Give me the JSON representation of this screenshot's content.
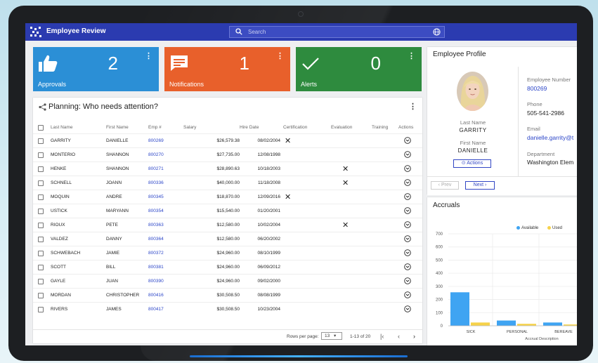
{
  "header": {
    "app_title": "Employee Review",
    "search_placeholder": "Search"
  },
  "tiles": [
    {
      "label": "Approvals",
      "count": "2",
      "color": "#2b8fd6",
      "icon": "thumbs-up-icon"
    },
    {
      "label": "Notifications",
      "count": "1",
      "color": "#e8602b",
      "icon": "message-icon"
    },
    {
      "label": "Alerts",
      "count": "0",
      "color": "#2e8b3e",
      "icon": "check-icon"
    }
  ],
  "planning": {
    "title": "Planning: Who needs attention?",
    "columns": [
      "Last Name",
      "First Name",
      "Emp #",
      "Salary",
      "Hire Date",
      "Certification",
      "Evaluation",
      "Training",
      "Actions"
    ],
    "rows": [
      {
        "last": "GARRITY",
        "first": "DANIELLE",
        "emp": "800269",
        "salary": "$26,579.38",
        "hire": "08/02/2004",
        "cert": "✕",
        "eval": ""
      },
      {
        "last": "MONTERIO",
        "first": "SHANNON",
        "emp": "800270",
        "salary": "$27,735.00",
        "hire": "12/08/1998",
        "cert": "",
        "eval": ""
      },
      {
        "last": "HENKE",
        "first": "SHANNON",
        "emp": "800271",
        "salary": "$28,890.63",
        "hire": "10/18/2003",
        "cert": "",
        "eval": "✕"
      },
      {
        "last": "SCHNELL",
        "first": "JOANN",
        "emp": "800336",
        "salary": "$40,000.00",
        "hire": "11/18/2008",
        "cert": "",
        "eval": "✕"
      },
      {
        "last": "MOQUIN",
        "first": "ANDRE",
        "emp": "800345",
        "salary": "$18,870.00",
        "hire": "12/09/2016",
        "cert": "✕",
        "eval": ""
      },
      {
        "last": "USTICK",
        "first": "MARYANN",
        "emp": "800354",
        "salary": "$15,540.00",
        "hire": "01/20/2001",
        "cert": "",
        "eval": ""
      },
      {
        "last": "RIOUX",
        "first": "PETE",
        "emp": "800363",
        "salary": "$12,580.00",
        "hire": "10/02/2004",
        "cert": "",
        "eval": "✕"
      },
      {
        "last": "VALDEZ",
        "first": "DANNY",
        "emp": "800364",
        "salary": "$12,580.00",
        "hire": "06/20/2002",
        "cert": "",
        "eval": ""
      },
      {
        "last": "SCHWEBACH",
        "first": "JAMIE",
        "emp": "800372",
        "salary": "$24,960.00",
        "hire": "08/10/1999",
        "cert": "",
        "eval": ""
      },
      {
        "last": "SCOTT",
        "first": "BILL",
        "emp": "800381",
        "salary": "$24,960.00",
        "hire": "06/09/2012",
        "cert": "",
        "eval": ""
      },
      {
        "last": "GAYLE",
        "first": "JUAN",
        "emp": "800390",
        "salary": "$24,960.00",
        "hire": "09/02/2000",
        "cert": "",
        "eval": ""
      },
      {
        "last": "MORDAN",
        "first": "CHRISTOPHER",
        "emp": "800416",
        "salary": "$30,508.50",
        "hire": "08/08/1999",
        "cert": "",
        "eval": ""
      },
      {
        "last": "RIVERS",
        "first": "JAMES",
        "emp": "800417",
        "salary": "$30,508.50",
        "hire": "10/23/2004",
        "cert": "",
        "eval": ""
      }
    ],
    "pager": {
      "rows_per_page_label": "Rows per page:",
      "rows_per_page": "13",
      "range": "1-13 of 20"
    }
  },
  "profile": {
    "title": "Employee Profile",
    "last_name_label": "Last Name",
    "last_name": "GARRITY",
    "first_name_label": "First Name",
    "first_name": "DANIELLE",
    "actions_label": "Actions",
    "employee_number_label": "Employee Number",
    "employee_number": "800269",
    "phone_label": "Phone",
    "phone": "505-541-2986",
    "email_label": "Email",
    "email": "danielle.garrity@t",
    "department_label": "Department",
    "department": "Washington Elem",
    "prev_label": "Prev",
    "next_label": "Next"
  },
  "accruals": {
    "title": "Accruals",
    "xlabel": "Accrual Description"
  },
  "chart_data": {
    "type": "bar",
    "categories": [
      "SICK",
      "PERSONAL",
      "BEREAVE"
    ],
    "series": [
      {
        "name": "Available",
        "values": [
          255,
          40,
          25
        ],
        "color": "#3fa4f2"
      },
      {
        "name": "Used",
        "values": [
          25,
          15,
          10
        ],
        "color": "#f6d24a"
      }
    ],
    "xlabel": "Accrual Description",
    "ylim": [
      0,
      700
    ],
    "yticks": [
      0,
      100,
      200,
      300,
      400,
      500,
      600,
      700
    ],
    "legend": "top-right"
  }
}
